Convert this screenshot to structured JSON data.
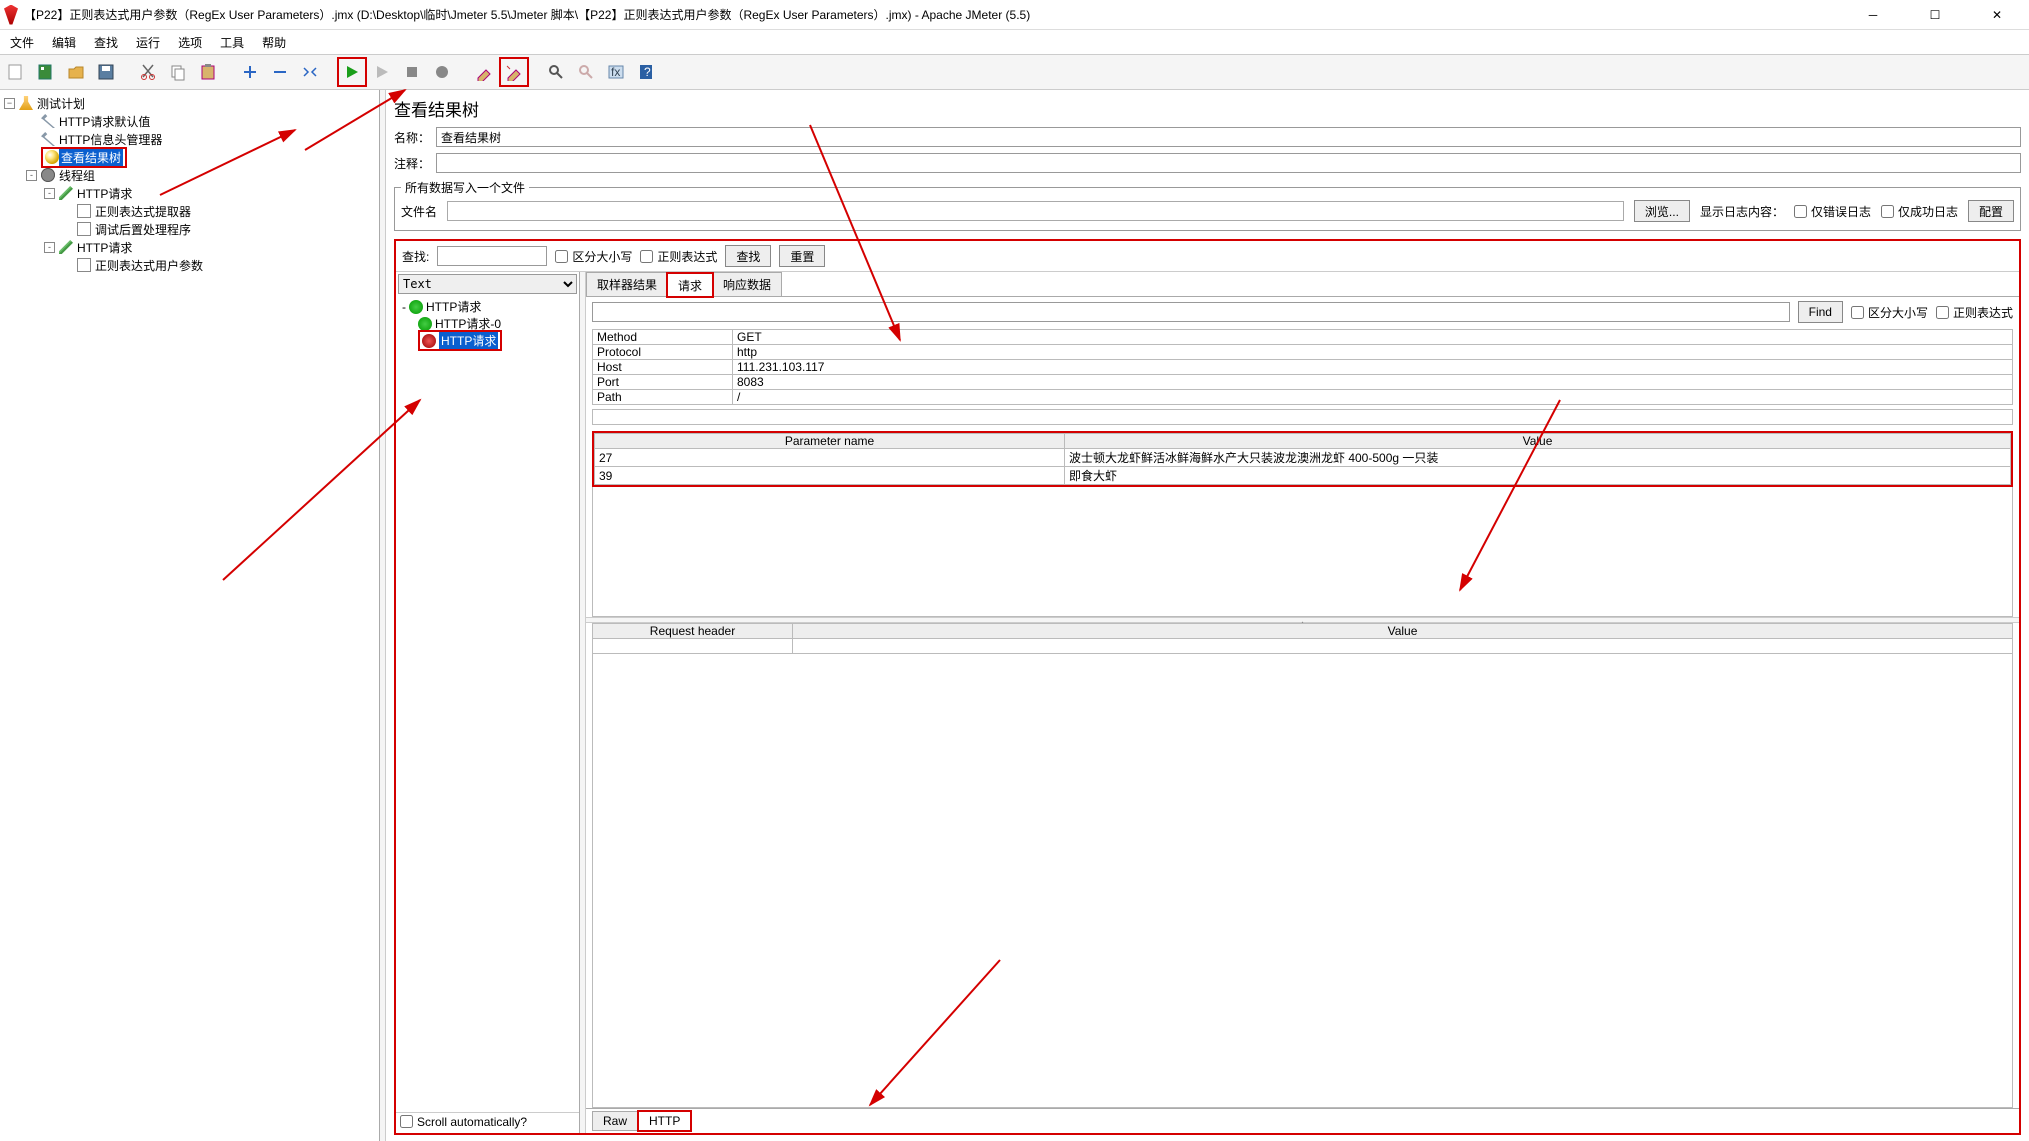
{
  "window": {
    "title": "【P22】正则表达式用户参数（RegEx User Parameters）.jmx (D:\\Desktop\\临时\\Jmeter 5.5\\Jmeter 脚本\\【P22】正则表达式用户参数（RegEx User Parameters）.jmx) - Apache JMeter (5.5)"
  },
  "menu": {
    "file": "文件",
    "edit": "编辑",
    "search": "查找",
    "run": "运行",
    "options": "选项",
    "tools": "工具",
    "help": "帮助"
  },
  "toolbar_icons": [
    "new",
    "templates",
    "open",
    "save",
    "cut",
    "copy",
    "paste",
    "plus",
    "minus",
    "wand",
    "start",
    "start-noto",
    "stop",
    "shutdown",
    "threads",
    "clear",
    "clearall",
    "find",
    "fn",
    "gear",
    "help"
  ],
  "tree": {
    "root": "测试计划",
    "items": [
      {
        "label": "HTTP请求默认值",
        "indent": 1,
        "icon": "wrench"
      },
      {
        "label": "HTTP信息头管理器",
        "indent": 1,
        "icon": "wrench"
      },
      {
        "label": "查看结果树",
        "indent": 1,
        "icon": "glass",
        "selected": true,
        "highlighted": true
      },
      {
        "label": "线程组",
        "indent": 1,
        "icon": "gear",
        "toggle": "-"
      },
      {
        "label": "HTTP请求",
        "indent": 2,
        "icon": "pencil",
        "toggle": "-"
      },
      {
        "label": "正则表达式提取器",
        "indent": 3,
        "icon": "page"
      },
      {
        "label": "调试后置处理程序",
        "indent": 3,
        "icon": "page"
      },
      {
        "label": "HTTP请求",
        "indent": 2,
        "icon": "pencil",
        "toggle": "-"
      },
      {
        "label": "正则表达式用户参数",
        "indent": 3,
        "icon": "page"
      }
    ]
  },
  "panel": {
    "title": "查看结果树",
    "name_label": "名称：",
    "name_value": "查看结果树",
    "comment_label": "注释：",
    "comment_value": "",
    "file_group_legend": "所有数据写入一个文件",
    "file_label": "文件名",
    "browse": "浏览...",
    "show_log": "显示日志内容：",
    "only_err": "仅错误日志",
    "only_ok": "仅成功日志",
    "config": "配置"
  },
  "search": {
    "label": "查找:",
    "case": "区分大小写",
    "regex": "正则表达式",
    "find": "查找",
    "reset": "重置"
  },
  "samplers": {
    "text_option": "Text",
    "items": [
      {
        "label": "HTTP请求",
        "status": "ok",
        "indent": 0,
        "toggle": "-"
      },
      {
        "label": "HTTP请求-0",
        "status": "ok",
        "indent": 1
      },
      {
        "label": "HTTP请求",
        "status": "err",
        "indent": 1,
        "selected": true,
        "highlighted": true
      }
    ],
    "scroll_label": "Scroll automatically?"
  },
  "tabs": {
    "sampler": "取样器结果",
    "request": "请求",
    "response": "响应数据"
  },
  "find": {
    "btn": "Find",
    "case": "区分大小写",
    "regex": "正则表达式"
  },
  "request_info": {
    "rows": [
      {
        "k": "Method",
        "v": "GET"
      },
      {
        "k": "Protocol",
        "v": "http"
      },
      {
        "k": "Host",
        "v": "111.231.103.117"
      },
      {
        "k": "Port",
        "v": "8083"
      },
      {
        "k": "Path",
        "v": "/"
      }
    ]
  },
  "params": {
    "header_name": "Parameter name",
    "header_value": "Value",
    "rows": [
      {
        "name": "27",
        "value": "波士顿大龙虾鲜活冰鲜海鲜水产大只装波龙澳洲龙虾 400-500g 一只装"
      },
      {
        "name": "39",
        "value": "即食大虾"
      }
    ]
  },
  "req_headers": {
    "name": "Request header",
    "value": "Value"
  },
  "bottom_tabs": {
    "raw": "Raw",
    "http": "HTTP"
  }
}
